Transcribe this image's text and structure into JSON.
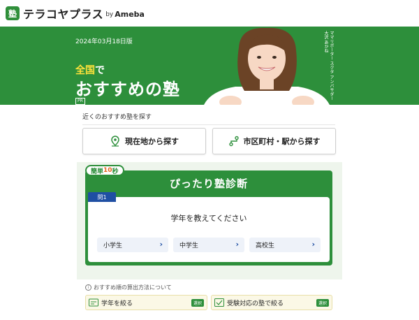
{
  "header": {
    "logo_mark": "塾",
    "logo_text": "テラコヤプラス",
    "logo_by": "by",
    "logo_ameba": "Ameba"
  },
  "hero": {
    "date": "2024年03月18日版",
    "small_highlight": "全国",
    "small_rest": "で",
    "title": "おすすめの塾",
    "pr": "PR",
    "vertical_text": "ママリボーター スクタ アンバサダー 大沢 あかね"
  },
  "search": {
    "section_label": "近くのおすすめ塾を探す",
    "current_location": "現在地から探す",
    "area_station": "市区町村・駅から探す"
  },
  "diagnosis": {
    "tag_prefix": "簡単",
    "tag_num": "10",
    "tag_suffix": "秒",
    "title": "ぴったり塾診断",
    "question_num": "問1",
    "question": "学年を教えてください",
    "choices": [
      "小学生",
      "中学生",
      "高校生"
    ]
  },
  "footer": {
    "info": "おすすめ順の算出方法について",
    "filter_grade": "学年を絞る",
    "filter_exam": "受験対応の塾で絞る",
    "badge": "選択"
  },
  "colors": {
    "brand_green": "#2d8f3b",
    "question_blue": "#1f4fa3",
    "highlight_yellow": "#ffe23a"
  }
}
